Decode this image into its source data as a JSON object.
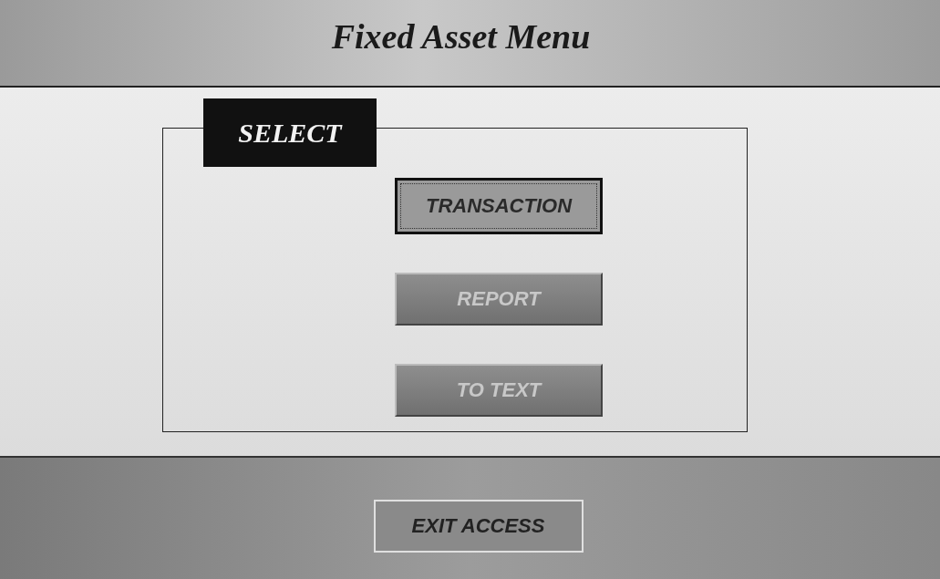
{
  "window": {
    "title": "Fixed Asset Menu"
  },
  "select_group": {
    "label": "SELECT",
    "buttons": [
      {
        "label": "TRANSACTION",
        "focused": true
      },
      {
        "label": "REPORT",
        "focused": false
      },
      {
        "label": "TO TEXT",
        "focused": false
      }
    ]
  },
  "footer": {
    "button": {
      "label": "EXIT ACCESS",
      "focused": false
    }
  }
}
